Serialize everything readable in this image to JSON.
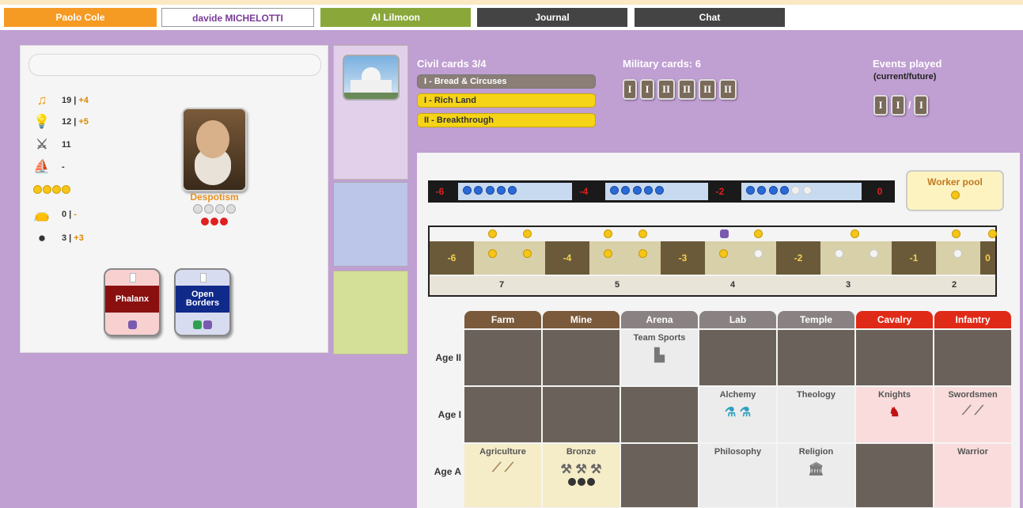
{
  "tabs": [
    {
      "label": "Paolo Cole",
      "bg": "#f59a23",
      "color": "#ffffff"
    },
    {
      "label": "davide MICHELOTTI",
      "bg": "#ffffff",
      "color": "#7a3a9a"
    },
    {
      "label": "Al Lilmoon",
      "bg": "#8aa83a",
      "color": "#ffffff"
    },
    {
      "label": "Journal",
      "bg": "#444444",
      "color": "#ffffff"
    },
    {
      "label": "Chat",
      "bg": "#444444",
      "color": "#ffffff"
    }
  ],
  "stats": {
    "culture": {
      "value": "19 |",
      "gain": "+4"
    },
    "science": {
      "value": "12 |",
      "gain": "+5"
    },
    "military": {
      "value": "11",
      "gain": ""
    },
    "colonize": {
      "value": "-",
      "gain": ""
    },
    "happy_count": 4,
    "food": {
      "value": "0 |",
      "gain": "-"
    },
    "resources": {
      "value": "3 |",
      "gain": "+3"
    }
  },
  "government": "Despotism",
  "tactics": [
    {
      "label": "Phalanx",
      "roman": "I",
      "bg": "#8a1010",
      "tile": "#f8d0d0"
    },
    {
      "label": "Open Borders",
      "roman": "I",
      "bg": "#102a8a",
      "tile": "#d8dcf0"
    }
  ],
  "civil": {
    "title": "Civil cards 3/4",
    "cards": [
      {
        "label": "I - Bread & Circuses",
        "bg": "#8a7e76",
        "color": "#ffffff"
      },
      {
        "label": "I - Rich Land",
        "bg": "#f5d418",
        "color": "#333333"
      },
      {
        "label": "II - Breakthrough",
        "bg": "#f5d418",
        "color": "#333333"
      }
    ]
  },
  "military_cards": {
    "title": "Military cards: 6",
    "cards": [
      "I",
      "I",
      "II",
      "II",
      "II",
      "II"
    ]
  },
  "events": {
    "title": "Events played",
    "subtitle": "(current/future)",
    "current": [
      "I",
      "I"
    ],
    "sep": "/",
    "future": [
      "I"
    ]
  },
  "pop_track": {
    "blocks": [
      "-6",
      "-4",
      "-2",
      "0"
    ]
  },
  "worker_pool": {
    "title": "Worker pool"
  },
  "store_track": {
    "labels": [
      "-6",
      "-4",
      "-3",
      "-2",
      "-1",
      "0"
    ],
    "bottom": [
      "7",
      "5",
      "4",
      "3",
      "2"
    ]
  },
  "columns": [
    {
      "label": "Farm",
      "bg": "#7a5a3a"
    },
    {
      "label": "Mine",
      "bg": "#7a5a3a"
    },
    {
      "label": "Arena",
      "bg": "#8a8282"
    },
    {
      "label": "Lab",
      "bg": "#8a8282"
    },
    {
      "label": "Temple",
      "bg": "#8a8282"
    },
    {
      "label": "Cavalry",
      "bg": "#e02a18"
    },
    {
      "label": "Infantry",
      "bg": "#e02a18"
    }
  ],
  "rows": [
    "Age II",
    "Age I",
    "Age A"
  ],
  "techs": {
    "arena_ii": "Team Sports",
    "lab_i": "Alchemy",
    "temple_i": "Theology",
    "cavalry_i": "Knights",
    "infantry_i": "Swordsmen",
    "farm_a": "Agriculture",
    "mine_a": "Bronze",
    "lab_a": "Philosophy",
    "temple_a": "Religion",
    "infantry_a": "Warrior"
  }
}
